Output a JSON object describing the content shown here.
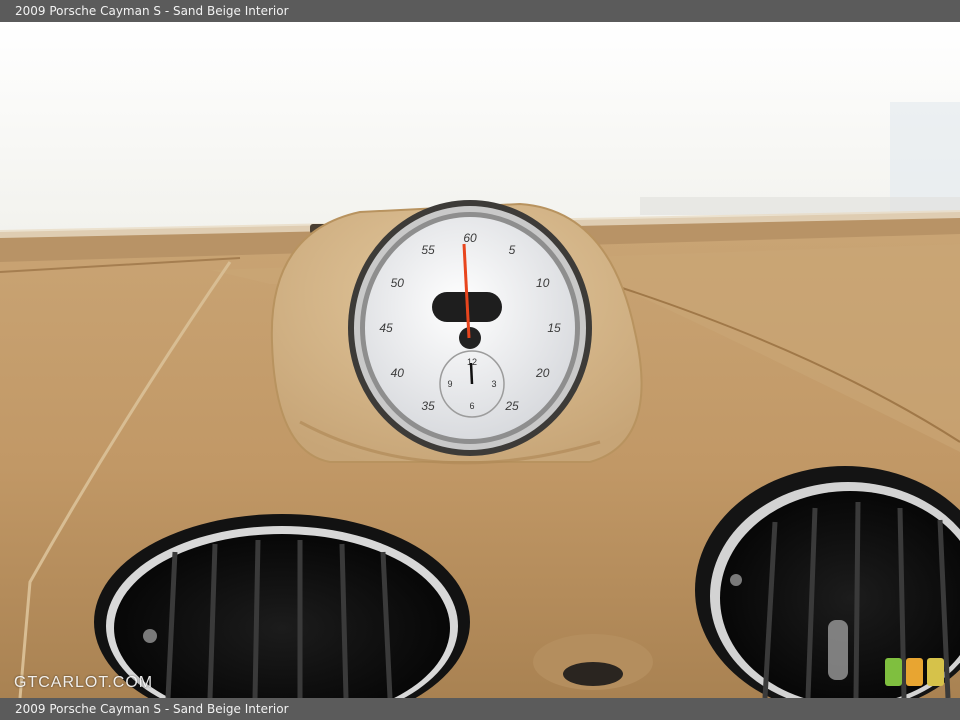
{
  "caption": {
    "title": "2009 Porsche Cayman S - Sand Beige Interior"
  },
  "watermark": {
    "text": "GTCARLOT.COM"
  },
  "clock": {
    "outer_numbers": [
      "60",
      "5",
      "10",
      "15",
      "20",
      "25",
      "35",
      "40",
      "45",
      "50",
      "55"
    ],
    "inner_numbers": [
      "12",
      "3",
      "6",
      "9"
    ]
  },
  "colors": {
    "dash_leather": "#c39a68",
    "dash_leather_dark": "#a57e50",
    "pod_leather": "#d6b98c",
    "needle": "#e8451d",
    "vent_chrome": "#d9d9d9",
    "sky": "#fbfbf8"
  },
  "badge_colors": [
    "#7fbf3f",
    "#e8a531",
    "#d6c24a"
  ]
}
